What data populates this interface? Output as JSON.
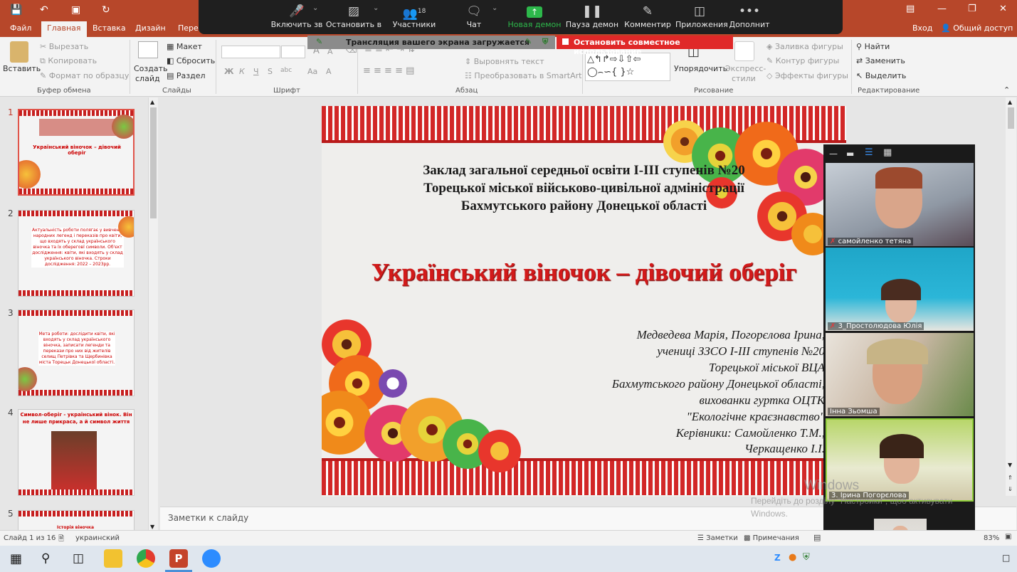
{
  "title_bar": {
    "login": "Вход",
    "share": "Общий доступ"
  },
  "tabs": [
    "Файл",
    "Главная",
    "Вставка",
    "Дизайн",
    "Пере"
  ],
  "zoom_toolbar": {
    "items": [
      {
        "label": "Включить зв",
        "icon": "mic-muted-icon"
      },
      {
        "label": "Остановить в",
        "icon": "video-icon"
      },
      {
        "label": "Участники",
        "icon": "participants-icon",
        "badge": "18"
      },
      {
        "label": "Чат",
        "icon": "chat-icon"
      },
      {
        "label": "Новая демон",
        "icon": "share-screen-icon"
      },
      {
        "label": "Пауза демон",
        "icon": "pause-icon"
      },
      {
        "label": "Комментир",
        "icon": "annotate-icon"
      },
      {
        "label": "Приложения",
        "icon": "apps-icon"
      },
      {
        "label": "Дополнит",
        "icon": "more-icon"
      }
    ],
    "sharing_status": "Трансляция вашего экрана загружается",
    "stop_share": "Остановить совместное использование"
  },
  "ribbon": {
    "clipboard": {
      "paste": "Вставить",
      "cut": "Вырезать",
      "copy": "Копировать",
      "format": "Формат по образцу",
      "label": "Буфер обмена"
    },
    "slides": {
      "new": "Создать",
      "new2": "слайд",
      "layout": "Макет",
      "reset": "Сбросить",
      "section": "Раздел",
      "label": "Слайды"
    },
    "font": {
      "label": "Шрифт",
      "bold": "Ж",
      "italic": "К",
      "underline": "Ч",
      "strike": "S",
      "spacing": "abc",
      "aa": "Аа",
      "a": "А"
    },
    "paragraph": {
      "label": "Абзац",
      "align_text": "Выровнять текст",
      "smartart": "Преобразовать в SmartArt"
    },
    "drawing": {
      "arrange": "Упорядочить",
      "express": "Экспресс-",
      "express2": "стили",
      "fill": "Заливка фигуры",
      "outline": "Контур фигуры",
      "effects": "Эффекты фигуры",
      "label": "Рисование"
    },
    "editing": {
      "find": "Найти",
      "replace": "Заменить",
      "select": "Выделить",
      "label": "Редактирование"
    }
  },
  "thumbnails": [
    {
      "num": "1",
      "text": "Український віночок – дівочий оберіг"
    },
    {
      "num": "2",
      "text": "Актуальність роботи полягає у вивченні народних легенд і переказів про квіти, що входять у склад українського віночка та їх обереговї символи. Об'єкт дослідження: квіти, які входять у склад українського віночка. Строки дослідження: 2022 – 2023рр."
    },
    {
      "num": "3",
      "text": "Мета роботи: дослідити квіти, які входять у склад українського віночка, записати легенди та перекази про них від жителів селищ Петрівка та Щербинівка міста Торецьк Донецької області."
    },
    {
      "num": "4",
      "text": "Символ-оберіг - український вінок. Він не лише прикраса, а й символ життя"
    },
    {
      "num": "5",
      "text": "Історія віночка"
    }
  ],
  "slide": {
    "school_lines": [
      "Заклад загальної середньої освіти І-ІІІ ступенів №20",
      "Торецької міської військово-цивільної адміністрації",
      "Бахмутського району Донецької області"
    ],
    "title": "Український віночок – дівочий оберіг",
    "authors": [
      "Медведева Марія, Погорєлова Ірина,",
      "учениці ЗЗСО І-ІІІ ступенів №20",
      "Торецької міської ВЦА",
      "Бахмутського району Донецької області,",
      "вихованки гуртка ОЦТК",
      "\"Екологічне краєзнавство\"",
      "Керівники: Самойленко Т.М.,",
      "Черкащенко І.І."
    ]
  },
  "notes_placeholder": "Заметки к слайду",
  "status_bar": {
    "slide_info": "Слайд 1 из 16",
    "language": "украинский",
    "notes": "Заметки",
    "comments": "Примечания",
    "zoom": "83%"
  },
  "participants": [
    {
      "name": "самойленко тетяна",
      "muted": true
    },
    {
      "name": "3_Простолюдова Юлія",
      "muted": true
    },
    {
      "name": "Інна Зьомша",
      "muted": false
    },
    {
      "name": "3. Ірина Погорєлова",
      "muted": false
    }
  ],
  "watermark": {
    "line1": "Windows",
    "line2": "Перейдіть до розділу \"Настройки\", щоб активувати",
    "line3": "Windows."
  },
  "colors": {
    "accent": "#b7472a",
    "title_red": "#d21a1a",
    "zoom_bg": "#1f1f1f",
    "share_green": "#2db84b",
    "stop_red": "#e02828"
  }
}
